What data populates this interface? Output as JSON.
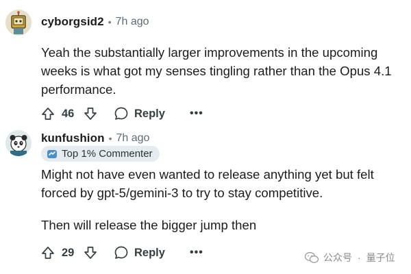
{
  "comments": [
    {
      "username": "cyborgsid2",
      "separator": "•",
      "time": "7h ago",
      "paragraphs": [
        "Yeah the substantially larger improvements in the upcoming weeks is what got my senses tingling rather than the Opus 4.1 performance."
      ],
      "votes": "46",
      "reply_label": "Reply",
      "more_label": "•••"
    },
    {
      "username": "kunfushion",
      "separator": "•",
      "time": "7h ago",
      "badge": "Top 1% Commenter",
      "paragraphs": [
        "Might not have even wanted to release anything yet but felt forced by gpt-5/gemini-3 to try to stay competitive.",
        "Then will release the bigger jump then"
      ],
      "votes": "29",
      "reply_label": "Reply",
      "more_label": "•••"
    }
  ],
  "watermark": {
    "account": "公众号",
    "separator": "·",
    "name": "量子位"
  },
  "colors": {
    "text": "#1c1c1c",
    "meta": "#5c6c74",
    "action": "#333d42",
    "badge_bg": "#e5ebee"
  }
}
